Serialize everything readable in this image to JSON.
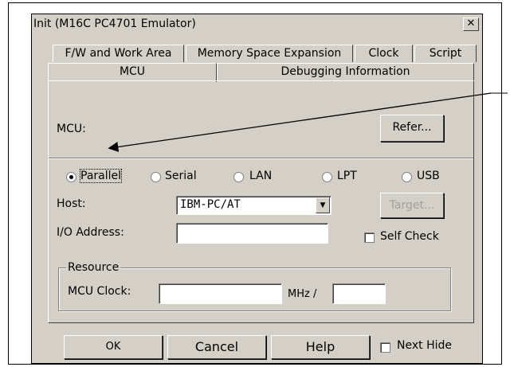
{
  "window": {
    "title": "Init (M16C PC4701 Emulator)",
    "close_symbol": "✕"
  },
  "tabs": {
    "row1": [
      "F/W and Work Area",
      "Memory Space Expansion",
      "Clock",
      "Script"
    ],
    "row2": [
      "MCU",
      "Debugging Information"
    ]
  },
  "mcu": {
    "label": "MCU:",
    "value": "",
    "refer_button": "Refer..."
  },
  "interface": {
    "options": [
      "Parallel",
      "Serial",
      "LAN",
      "LPT",
      "USB"
    ],
    "selected": "Parallel"
  },
  "host": {
    "label": "Host:",
    "value": "IBM-PC/AT",
    "target_button": "Target..."
  },
  "io_address": {
    "label": "I/O Address:",
    "value": ""
  },
  "self_check": {
    "label": "Self Check",
    "checked": false
  },
  "resource": {
    "group_label": "Resource",
    "mcu_clock_label": "MCU Clock:",
    "mcu_clock_value": "",
    "unit": "MHz /",
    "divider_value": ""
  },
  "footer": {
    "ok": "OK",
    "cancel": "Cancel",
    "help": "Help",
    "next_hide": "Next Hide",
    "next_hide_checked": false
  }
}
